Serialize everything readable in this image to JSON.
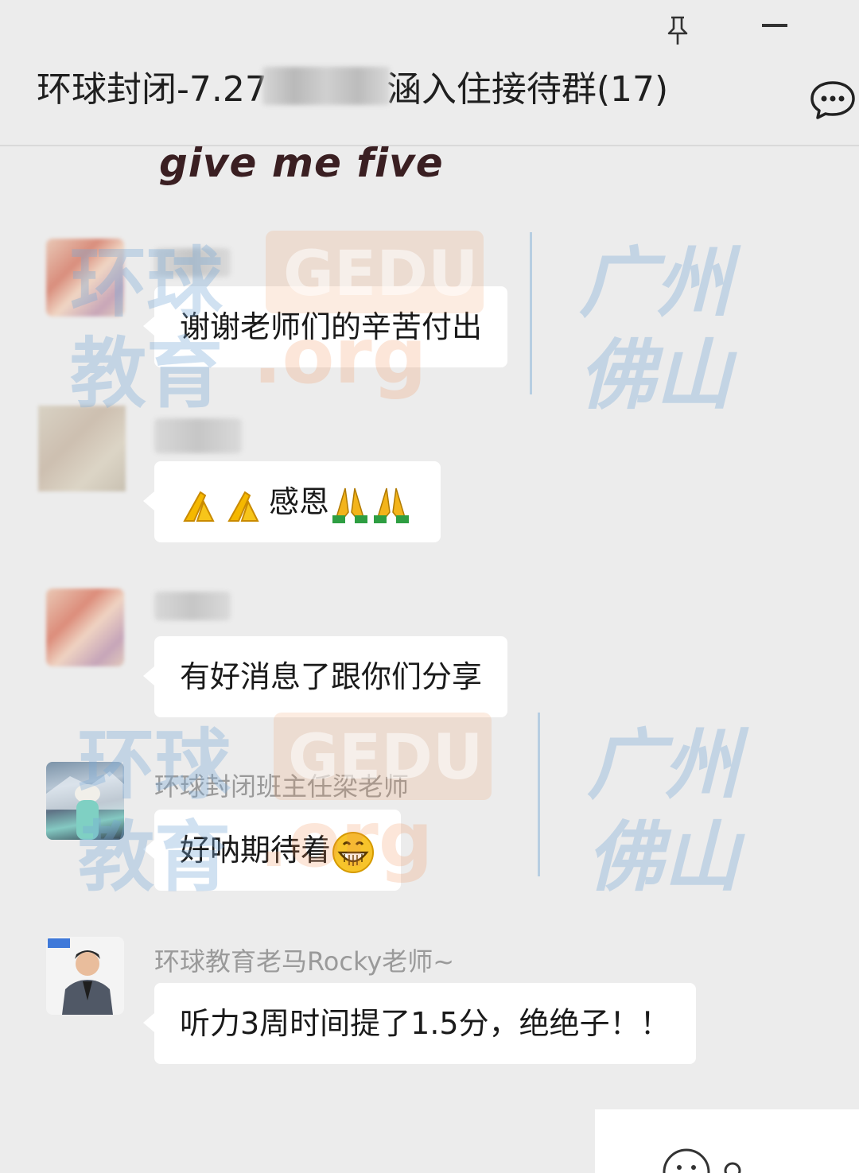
{
  "window": {
    "title": "环球封闭-7.27",
    "title_suffix": "涵入住接待群(17)"
  },
  "sticker": {
    "text": "give me five"
  },
  "messages": [
    {
      "sender": "",
      "text": "谢谢老师们的辛苦付出"
    },
    {
      "sender": "",
      "text": "感恩",
      "emoji_before": [
        "folded-hands-emoji",
        "folded-hands-emoji"
      ],
      "emoji_after": [
        "folded-hands-emoji",
        "folded-hands-emoji"
      ]
    },
    {
      "sender": "",
      "text": "有好消息了跟你们分享"
    },
    {
      "sender": "环球封闭班主任梁老师",
      "text": "好呐期待着",
      "emoji_after": [
        "grinning-face-emoji"
      ]
    },
    {
      "sender": "环球教育老马Rocky老师~",
      "text": "听力3周时间提了1.5分，绝绝子！！"
    }
  ],
  "watermark": {
    "line1_cn": "环球",
    "brand": "GEDU",
    "line2_cn": "教育",
    "domain": ".org",
    "city1": "广州",
    "city2": "佛山"
  },
  "colors": {
    "background": "#ececec",
    "bubble": "#ffffff",
    "sender_name": "#9a9a9a",
    "watermark_blue": "#78aad7",
    "watermark_orange": "#f08c50"
  }
}
